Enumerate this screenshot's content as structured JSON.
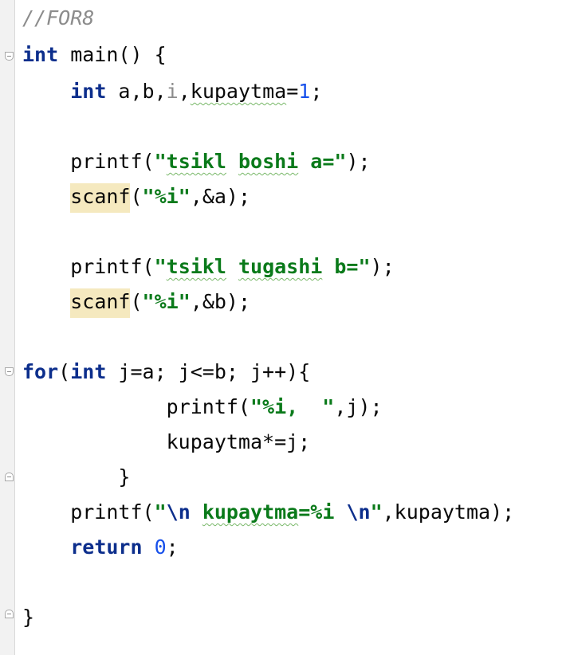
{
  "editor": {
    "lines": [
      [
        {
          "t": "//FOR8",
          "c": "cmt"
        }
      ],
      [
        {
          "t": "int",
          "c": "kw"
        },
        {
          "t": " main() {"
        }
      ],
      [
        {
          "t": "    "
        },
        {
          "t": "int",
          "c": "kw"
        },
        {
          "t": " a,b,"
        },
        {
          "t": "i",
          "c": "dim"
        },
        {
          "t": ","
        },
        {
          "t": "kupaytma",
          "c": "typo"
        },
        {
          "t": "="
        },
        {
          "t": "1",
          "c": "num"
        },
        {
          "t": ";"
        }
      ],
      [],
      [
        {
          "t": "    printf("
        },
        {
          "t": "\"",
          "c": "str"
        },
        {
          "t": "tsikl",
          "c": "str typo"
        },
        {
          "t": " ",
          "c": "str"
        },
        {
          "t": "boshi",
          "c": "str typo"
        },
        {
          "t": " a=\"",
          "c": "str"
        },
        {
          "t": ");"
        }
      ],
      [
        {
          "t": "    "
        },
        {
          "t": "scanf",
          "c": "hl"
        },
        {
          "t": "("
        },
        {
          "t": "\"%i\"",
          "c": "str"
        },
        {
          "t": ",&a);"
        }
      ],
      [],
      [
        {
          "t": "    printf("
        },
        {
          "t": "\"",
          "c": "str"
        },
        {
          "t": "tsikl",
          "c": "str typo"
        },
        {
          "t": " ",
          "c": "str"
        },
        {
          "t": "tugashi",
          "c": "str typo"
        },
        {
          "t": " b=\"",
          "c": "str"
        },
        {
          "t": ");"
        }
      ],
      [
        {
          "t": "    "
        },
        {
          "t": "scanf",
          "c": "hl"
        },
        {
          "t": "("
        },
        {
          "t": "\"%i\"",
          "c": "str"
        },
        {
          "t": ",&b);"
        }
      ],
      [],
      [
        {
          "t": "for",
          "c": "kw"
        },
        {
          "t": "("
        },
        {
          "t": "int",
          "c": "kw"
        },
        {
          "t": " j=a; j<=b; j++){"
        }
      ],
      [
        {
          "t": "            printf("
        },
        {
          "t": "\"%i,  \"",
          "c": "str"
        },
        {
          "t": ",j);"
        }
      ],
      [
        {
          "t": "            kupaytma*=j;"
        }
      ],
      [
        {
          "t": "        }"
        }
      ],
      [
        {
          "t": "    printf("
        },
        {
          "t": "\"",
          "c": "str"
        },
        {
          "t": "\\n",
          "c": "esc"
        },
        {
          "t": " ",
          "c": "str"
        },
        {
          "t": "kupaytma",
          "c": "str typo"
        },
        {
          "t": "=%i ",
          "c": "str"
        },
        {
          "t": "\\n",
          "c": "esc"
        },
        {
          "t": "\"",
          "c": "str"
        },
        {
          "t": ",kupaytma);"
        }
      ],
      [
        {
          "t": "    "
        },
        {
          "t": "return",
          "c": "kw"
        },
        {
          "t": " "
        },
        {
          "t": "0",
          "c": "num"
        },
        {
          "t": ";"
        }
      ],
      [],
      [
        {
          "t": "}"
        }
      ]
    ]
  }
}
